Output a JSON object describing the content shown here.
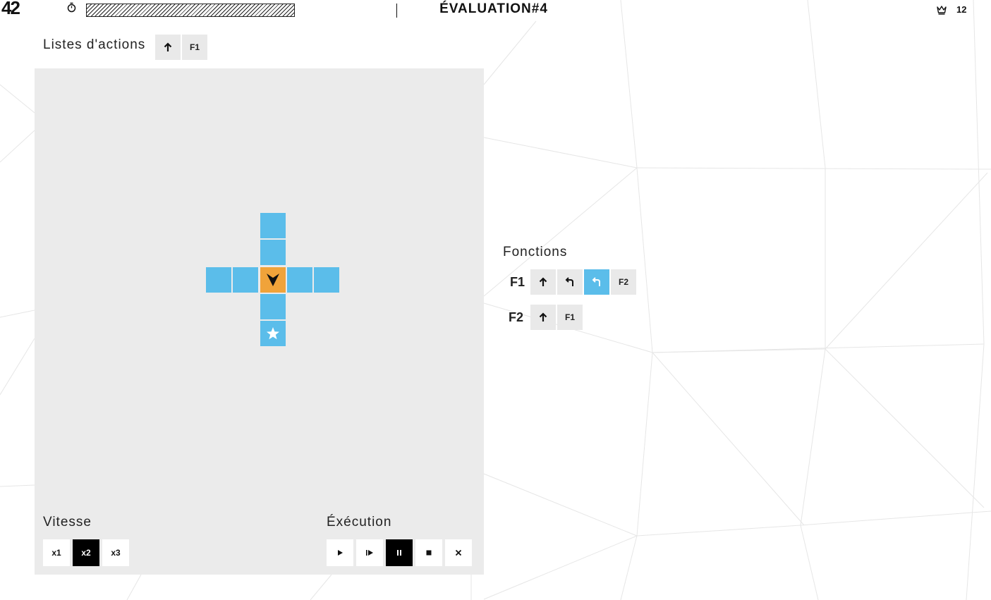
{
  "header": {
    "logo": "42",
    "title": "ÉVALUATION#4",
    "score": "12"
  },
  "actions": {
    "label": "Listes d'actions",
    "slots": [
      {
        "icon": "arrow-up-icon"
      },
      {
        "text": "F1"
      }
    ]
  },
  "functions": {
    "label": "Fonctions",
    "f1": {
      "name": "F1",
      "slots": [
        {
          "icon": "arrow-up-icon"
        },
        {
          "icon": "turn-left-icon"
        },
        {
          "icon": "turn-left-icon",
          "active": true
        },
        {
          "text": "F2"
        }
      ]
    },
    "f2": {
      "name": "F2",
      "slots": [
        {
          "icon": "arrow-up-icon"
        },
        {
          "text": "F1"
        }
      ]
    }
  },
  "speed": {
    "label": "Vitesse",
    "options": [
      "x1",
      "x2",
      "x3"
    ],
    "selected": "x2"
  },
  "execution": {
    "label": "Éxécution",
    "buttons": [
      "play-icon",
      "step-icon",
      "pause-icon",
      "stop-icon",
      "close-icon"
    ],
    "selected": "pause-icon"
  },
  "colors": {
    "tile": "#5bbdea",
    "robot_tile": "#f0a33a",
    "board": "#ebebeb",
    "slot": "#e9e9e9"
  }
}
